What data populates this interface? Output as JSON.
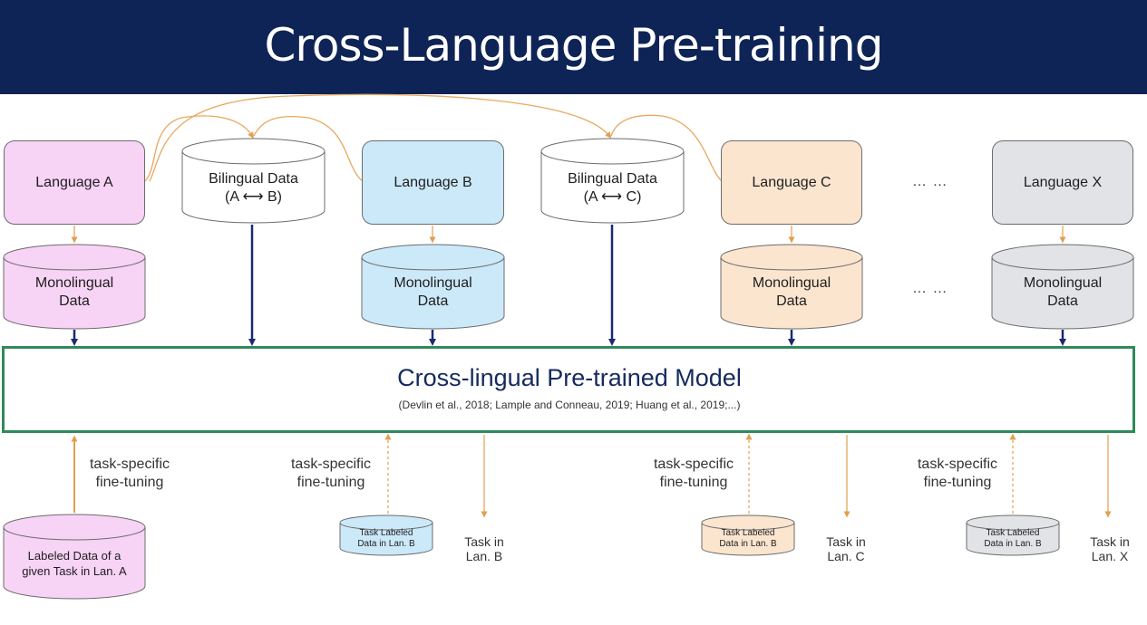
{
  "title": "Cross-Language Pre-training",
  "languages": [
    {
      "label": "Language A",
      "color": "#f7d3f5"
    },
    {
      "label": "Language B",
      "color": "#cce9fa"
    },
    {
      "label": "Language C",
      "color": "#fbe5cf"
    },
    {
      "label": "Language X",
      "color": "#e2e3e7"
    }
  ],
  "bilingual": [
    {
      "line1": "Bilingual Data",
      "line2": "(A ⟷ B)"
    },
    {
      "line1": "Bilingual Data",
      "line2": "(A ⟷ C)"
    }
  ],
  "monolingual_label": "Monolingual\nData",
  "ellipsis": "… …",
  "model": {
    "title": "Cross-lingual Pre-trained Model",
    "citation": "(Devlin et al., 2018; Lample and Conneau, 2019; Huang et al., 2019;...)"
  },
  "fine_tuning_label": "task-specific\nfine-tuning",
  "labeled_a": "Labeled Data of a\ngiven Task in Lan. A",
  "task_labeled": [
    "Task Labeled\nData in Lan. B",
    "Task Labeled\nData in Lan. B",
    "Task Labeled\nData in Lan. B"
  ],
  "tasks": [
    "Task in\nLan. B",
    "Task in\nLan. C",
    "Task in\nLan. X"
  ],
  "colors": {
    "header": "#0f2456",
    "arrow_dark": "#1a2a6e",
    "arrow_orange": "#e0a050",
    "model_border": "#2f8a5a"
  }
}
